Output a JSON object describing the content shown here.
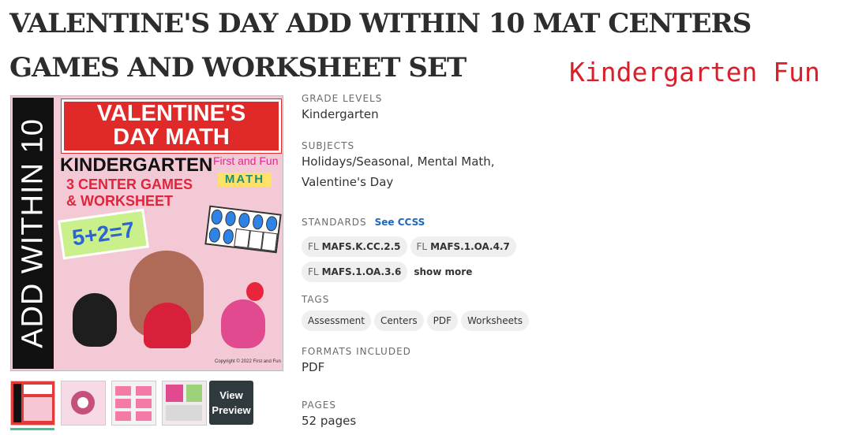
{
  "product": {
    "title": "VALENTINE'S DAY ADD WITHIN 10 MAT CENTERS GAMES AND WORKSHEET SET",
    "seller_name": "Kindergarten Fun"
  },
  "cover": {
    "side_text": "ADD WITHIN 10",
    "banner_line1": "VALENTINE'S",
    "banner_line2": "DAY MATH",
    "grade": "KINDERGARTEN",
    "brand": "First and Fun",
    "brand_badge": "MATH",
    "subtitle_line1": "3 CENTER GAMES",
    "subtitle_line2": "& WORKSHEET",
    "equation": "5+2=7",
    "copyright": "Copyright © 2022 First and Fun"
  },
  "gallery": {
    "view_preview_line1": "View",
    "view_preview_line2": "Preview",
    "thumbs": [
      "thumb-cover",
      "thumb-game",
      "thumb-cards",
      "thumb-worksheet"
    ],
    "selected_index": 0
  },
  "details": {
    "grade_levels": {
      "label": "GRADE LEVELS",
      "value": "Kindergarten"
    },
    "subjects": {
      "label": "SUBJECTS",
      "line1": "Holidays/Seasonal, Mental Math,",
      "line2": "Valentine's Day"
    },
    "standards": {
      "label": "STANDARDS",
      "link": "See CCSS",
      "items": [
        {
          "state": "FL",
          "code": "MAFS.K.CC.2.5"
        },
        {
          "state": "FL",
          "code": "MAFS.1.OA.4.7"
        },
        {
          "state": "FL",
          "code": "MAFS.1.OA.3.6"
        }
      ],
      "show_more": "show more"
    },
    "tags": {
      "label": "TAGS",
      "items": [
        "Assessment",
        "Centers",
        "PDF",
        "Worksheets"
      ]
    },
    "formats": {
      "label": "FORMATS INCLUDED",
      "value": "PDF"
    },
    "pages": {
      "label": "PAGES",
      "value": "52 pages"
    }
  },
  "colors": {
    "seller": "#d81f2a",
    "link": "#1f67b9",
    "selected_thumb": "#48c18e",
    "view_button": "#2f3a3f"
  }
}
